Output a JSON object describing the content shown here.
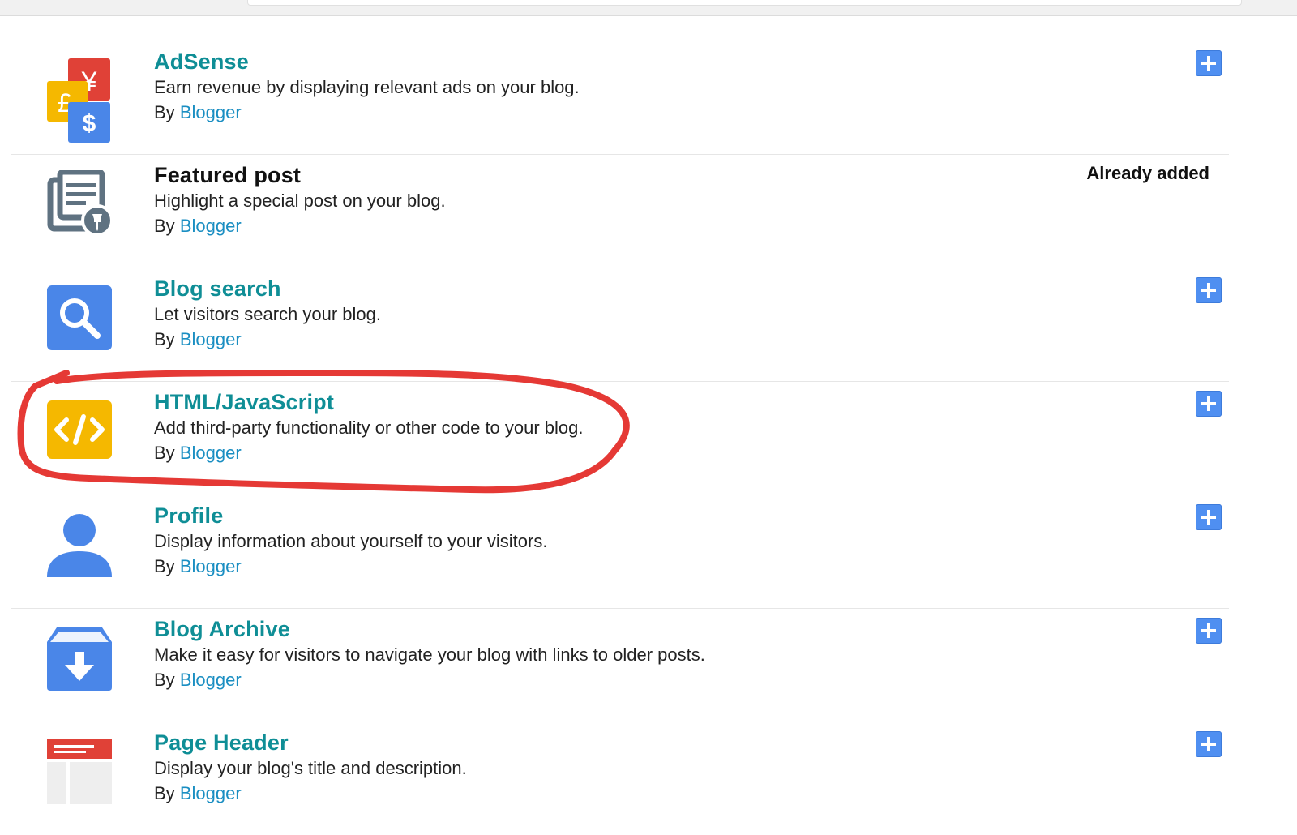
{
  "gadgets": [
    {
      "title": "AdSense",
      "description": "Earn revenue by displaying relevant ads on your blog.",
      "by_prefix": "By",
      "author": "Blogger",
      "icon": "adsense-icon",
      "status": "add"
    },
    {
      "title": "Featured post",
      "description": "Highlight a special post on your blog.",
      "by_prefix": "By",
      "author": "Blogger",
      "icon": "featured-post-icon",
      "status": "Already added"
    },
    {
      "title": "Blog search",
      "description": "Let visitors search your blog.",
      "by_prefix": "By",
      "author": "Blogger",
      "icon": "search-icon",
      "status": "add"
    },
    {
      "title": "HTML/JavaScript",
      "description": "Add third-party functionality or other code to your blog.",
      "by_prefix": "By",
      "author": "Blogger",
      "icon": "code-icon",
      "status": "add"
    },
    {
      "title": "Profile",
      "description": "Display information about yourself to your visitors.",
      "by_prefix": "By",
      "author": "Blogger",
      "icon": "profile-icon",
      "status": "add"
    },
    {
      "title": "Blog Archive",
      "description": "Make it easy for visitors to navigate your blog with links to older posts.",
      "by_prefix": "By",
      "author": "Blogger",
      "icon": "archive-icon",
      "status": "add"
    },
    {
      "title": "Page Header",
      "description": "Display your blog's title and description.",
      "by_prefix": "By",
      "author": "Blogger",
      "icon": "page-header-icon",
      "status": "add"
    }
  ],
  "colors": {
    "title_link": "#0f8e96",
    "author_link": "#1a8ec2",
    "add_button": "#4f8ff1",
    "annotation": "#e53935"
  }
}
